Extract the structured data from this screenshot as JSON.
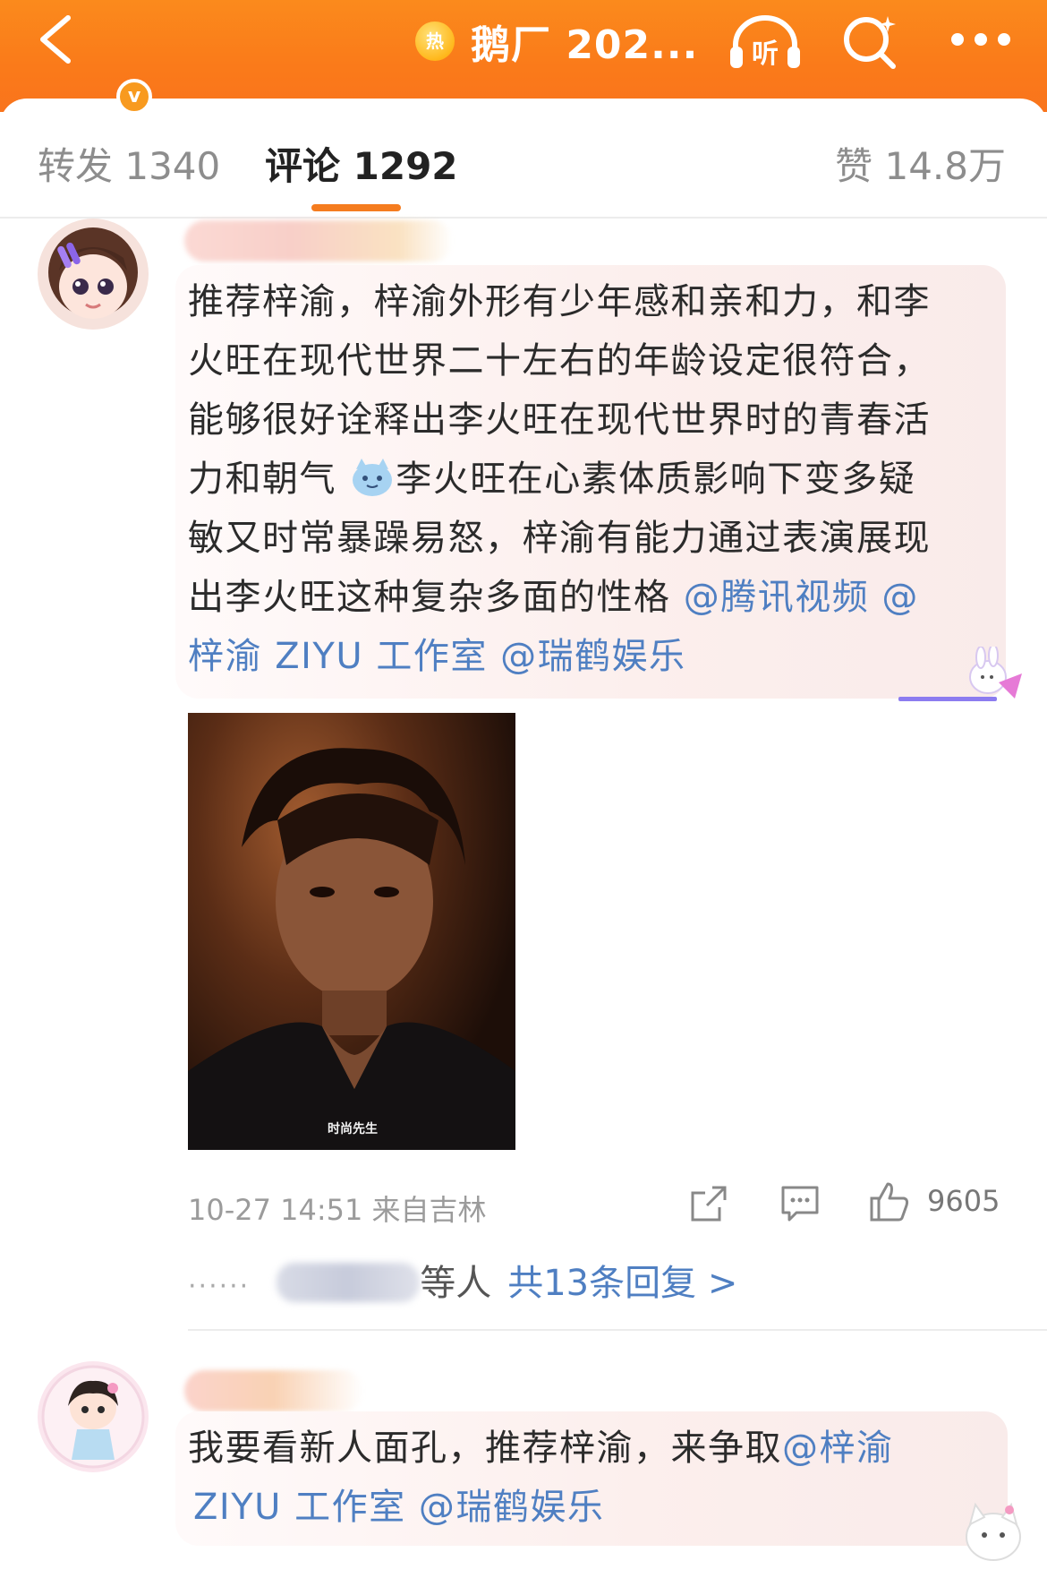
{
  "header": {
    "back_icon": "chevron-left-icon",
    "hot_badge": "热",
    "title": "鹅厂 202...",
    "listen_label": "听",
    "search_icon": "search-icon",
    "more_icon": "more-dots-icon",
    "bar_color": "#f97b1c"
  },
  "tabs": {
    "repost": "转发 1340",
    "comments": "评论 1292",
    "likes": "赞 14.8万",
    "indicator_color": "#f57c1f"
  },
  "comments": [
    {
      "text_lines": [
        "推荐梓渝，梓渝外形有少年感和亲和力，和李",
        "火旺在现代世界二十左右的年龄设定很符合，",
        "能够很好诠释出李火旺在现代世界时的青春活",
        "力和朝气",
        "李火旺在心素体质影响下变多疑",
        "敏又时常暴躁易怒，梓渝有能力通过表演展现",
        "出李火旺这种复杂多面的性格 ",
        "@腾讯视频",
        " @",
        "梓渝 ZIYU 工作室",
        " ",
        "@瑞鹤娱乐"
      ],
      "photo_caption": "时尚先生",
      "timestamp": "10-27 14:51 来自吉林",
      "like_count": "9605",
      "replies_suffix": "等人",
      "replies_link": "共13条回复 >"
    },
    {
      "text_main": "我要看新人面孔，推荐梓渝，来争取",
      "mention_1": "@梓渝",
      "mention_2": "ZIYU 工作室",
      "mention_3": "@瑞鹤娱乐"
    }
  ],
  "colors": {
    "mention": "#4f7fc2",
    "verified": "#f89a1f"
  }
}
